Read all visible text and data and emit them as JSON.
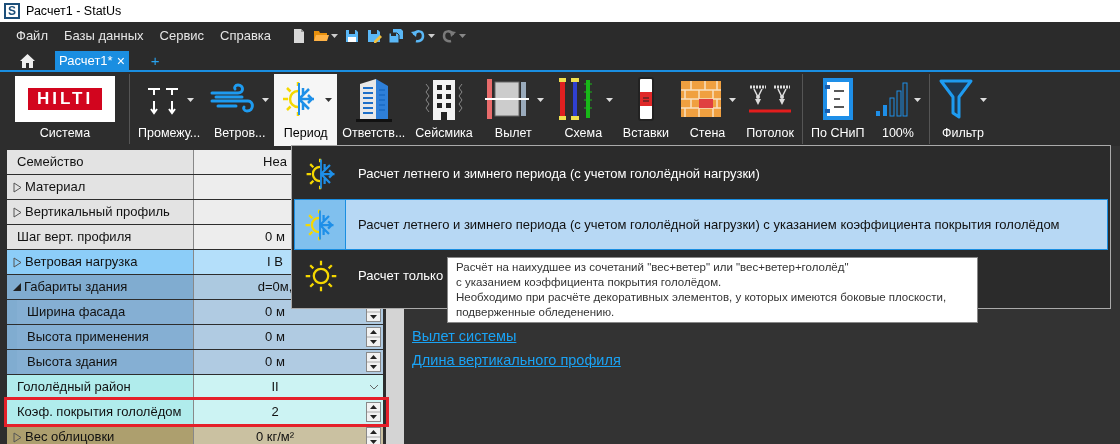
{
  "window": {
    "title": "Расчет1 - StatUs",
    "app_logo": "S"
  },
  "menu": [
    {
      "label": "Файл"
    },
    {
      "label": "Базы данных"
    },
    {
      "label": "Сервис"
    },
    {
      "label": "Справка"
    }
  ],
  "toolbar": [
    {
      "dropdown": false,
      "disabled": false
    },
    {
      "dropdown": true,
      "disabled": false
    },
    {
      "dropdown": false,
      "disabled": false
    },
    {
      "dropdown": false,
      "disabled": false
    },
    {
      "dropdown": false,
      "disabled": false
    },
    {
      "dropdown": true,
      "disabled": false
    },
    {
      "dropdown": true,
      "disabled": true
    }
  ],
  "document_tabs": [
    {
      "label": "Расчет1*",
      "selected": true,
      "close": "×"
    }
  ],
  "new_tab": "+",
  "ribbon": {
    "groups": [
      {
        "buttons": [
          {
            "label": "Система",
            "logo": "HILTI",
            "dropdown": false,
            "selected": false
          }
        ]
      },
      {
        "buttons": [
          {
            "label": "Промежу...",
            "dropdown": true,
            "selected": false
          },
          {
            "label": "Ветров...",
            "dropdown": true,
            "selected": false
          },
          {
            "label": "Период",
            "dropdown": true,
            "selected": true
          },
          {
            "label": "Ответств...",
            "dropdown": false,
            "selected": false
          },
          {
            "label": "Сейсмика",
            "dropdown": false,
            "selected": false
          },
          {
            "label": "Вылет",
            "dropdown": true,
            "selected": false
          },
          {
            "label": "Схема",
            "dropdown": true,
            "selected": false
          },
          {
            "label": "Вставки",
            "dropdown": false,
            "selected": false
          },
          {
            "label": "Стена",
            "dropdown": true,
            "selected": false
          },
          {
            "label": "Потолок",
            "dropdown": false,
            "selected": false
          }
        ]
      },
      {
        "buttons": [
          {
            "label": "По СНиП",
            "dropdown": false,
            "selected": false
          },
          {
            "label": "100%",
            "dropdown": true,
            "selected": false
          }
        ]
      },
      {
        "buttons": [
          {
            "label": "Фильтр",
            "dropdown": true,
            "selected": false
          }
        ]
      }
    ]
  },
  "property_grid": {
    "rows": [
      {
        "name": "Семейство",
        "value": "Hea",
        "kind": "text",
        "color": "#e3e3e3"
      },
      {
        "name": "Материал",
        "kind": "text",
        "color": "#e3e3e3",
        "expanded": false
      },
      {
        "name": "Вертикальный профиль",
        "kind": "text",
        "color": "#e3e3e3",
        "expanded": false
      },
      {
        "name": "Шаг верт. профиля",
        "value": "0 м",
        "kind": "text",
        "color": "#e3e3e3"
      },
      {
        "name": "Ветровая нагрузка",
        "value": "I В",
        "kind": "text",
        "color": "#8ccdf8",
        "expanded": false
      },
      {
        "name": "Габариты здания",
        "value": "d=0м,",
        "kind": "text",
        "color": "#80acd0",
        "expanded": true,
        "children": [
          {
            "name": "Ширина фасада",
            "value": "0 м",
            "kind": "spinner",
            "color": "#85afd3"
          },
          {
            "name": "Высота применения",
            "value": "0 м",
            "kind": "spinner",
            "color": "#85afd3"
          },
          {
            "name": "Высота здания",
            "value": "0 м",
            "kind": "spinner",
            "color": "#85afd3"
          }
        ]
      },
      {
        "name": "Гололёдный район",
        "value": "II",
        "kind": "dropdown",
        "color": "#b0ecec"
      },
      {
        "name": "Коэф. покрытия гололёдом",
        "value": "2",
        "kind": "spinner",
        "color": "#b0ecec",
        "highlighted": true
      },
      {
        "name": "Вес облицовки",
        "value": "0 кг/м²",
        "kind": "spinner",
        "color": "#ad9f6e",
        "expanded": false
      }
    ]
  },
  "links": [
    {
      "label": "Вылет системы"
    },
    {
      "label": "Длина вертикального профиля"
    }
  ],
  "period_menu": {
    "items": [
      {
        "label": "Расчет летнего и зимнего периода (с учетом гололёдной нагрузки)",
        "selected": false
      },
      {
        "label": "Расчет летнего и зимнего периода (с учетом гололёдной нагрузки) с указанием коэффициента покрытия гололёдом",
        "selected": true
      },
      {
        "label": "Расчет только",
        "selected": false
      }
    ]
  },
  "tooltip": {
    "text": "Расчёт на наихудшее из сочетаний \"вес+ветер\" или \"вес+ветер+гололёд\"\nс указанием коэффициента покрытия гололёдом.\nНеобходимо при расчёте декоративных элементов, у которых имеются боковые плоскости,\nподверженные обледенению."
  }
}
